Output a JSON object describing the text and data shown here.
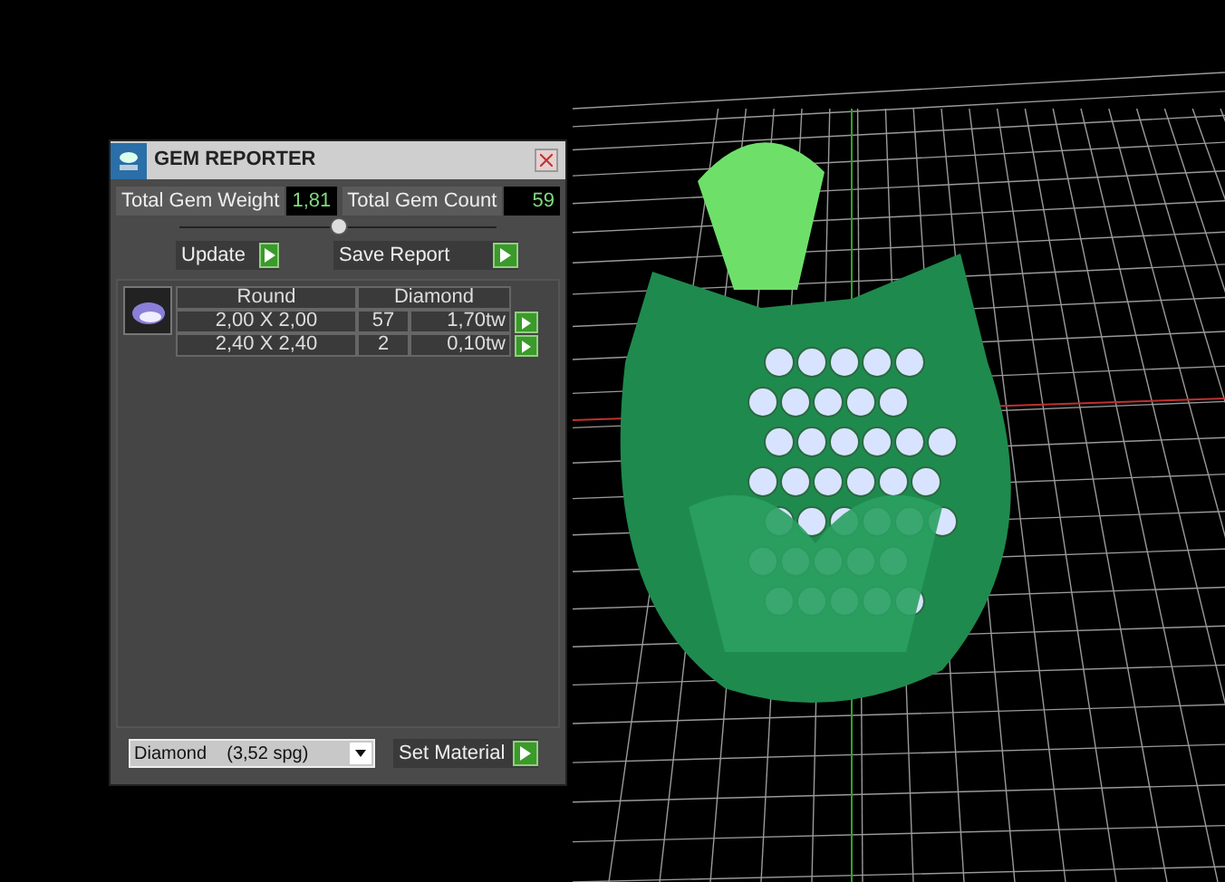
{
  "window": {
    "title": "GEM REPORTER"
  },
  "totals": [
    {
      "label": "Total Gem Weight",
      "value": "1,81"
    },
    {
      "label": "Total Gem Count",
      "value": "59"
    }
  ],
  "slider": {
    "level": 0.5
  },
  "actions": [
    "Update",
    "Save Report"
  ],
  "table": {
    "columns": [
      "Round",
      "Diamond"
    ],
    "rows": [
      {
        "size": "2,00 X 2,00",
        "count": "57",
        "weight": "1,70tw"
      },
      {
        "size": "2,40 X 2,40",
        "count": "2",
        "weight": "0,10tw"
      }
    ]
  },
  "material": {
    "value": "Diamond    (3,52 spg)",
    "button": "Set Material"
  }
}
